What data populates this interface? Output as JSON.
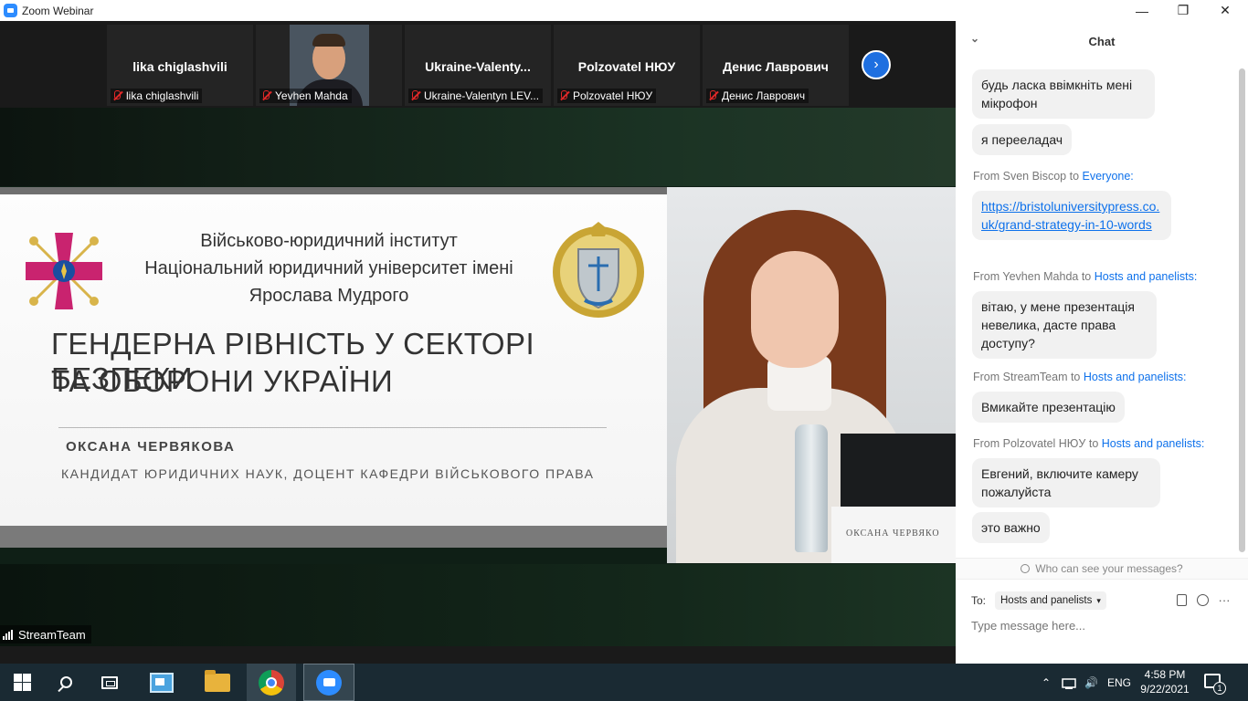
{
  "window": {
    "title": "Zoom Webinar",
    "minimize": "—",
    "restore": "❐",
    "close": "✕"
  },
  "participants": [
    {
      "name": "lika chiglashvili",
      "label": "lika chiglashvili"
    },
    {
      "name": "",
      "label": "Yevhen Mahda"
    },
    {
      "name": "Ukraine-Valenty...",
      "label": "Ukraine-Valentyn LEV..."
    },
    {
      "name": "Polzovatel НЮУ",
      "label": "Polzovatel НЮУ"
    },
    {
      "name": "Денис Лаврович",
      "label": "Денис Лаврович"
    }
  ],
  "next_arrow": "›",
  "slide": {
    "institute_line1": "Військово-юридичний інститут",
    "institute_line2": "Національний юридичний університет імені",
    "institute_line3": "Ярослава Мудрого",
    "title_line1": "ГЕНДЕРНА РІВНІСТЬ У СЕКТОРІ БЕЗПЕКИ",
    "title_line2": "ТА ОБОРОНИ УКРАЇНИ",
    "author": "ОКСАНА ЧЕРВЯКОВА",
    "degree": "КАНДИДАТ ЮРИДИЧНИХ НАУК, ДОЦЕНТ КАФЕДРИ ВІЙСЬКОВОГО ПРАВА"
  },
  "speaker_nameplate": "ОКСАНА ЧЕРВЯКО",
  "active_speaker": "StreamTeam",
  "chat": {
    "title": "Chat",
    "collapse_icon": "⌄",
    "messages": [
      {
        "text": "будь ласка ввімкніть мені мікрофон"
      },
      {
        "text": "я переeладач"
      },
      {
        "from": "From Sven Biscop to ",
        "to": "Everyone:",
        "text": "https://bristoluniversitypress.co.uk/grand-strategy-in-10-words"
      },
      {
        "from": "From Yevhen Mahda to ",
        "to": "Hosts and panelists:",
        "text": "вітаю, у мене презентація невелика, дасте права доступу?"
      },
      {
        "from": "From StreamTeam to ",
        "to": "Hosts and panelists:",
        "text": "Вмикайте презентацію"
      },
      {
        "from": "From Polzovatel НЮУ to ",
        "to": "Hosts and panelists:",
        "text": "Евгений, включите камеру пожалуйста"
      },
      {
        "text": "это важно"
      }
    ],
    "privacy": "Who can see your messages?",
    "to_label": "To:",
    "recipient": "Hosts and panelists",
    "more": "···",
    "placeholder": "Type message here..."
  },
  "taskbar": {
    "lang": "ENG",
    "time": "4:58 PM",
    "date": "9/22/2021",
    "notif_count": "1",
    "tray_up": "⌃",
    "volume": "🔊"
  },
  "colors": {
    "accent": "#0e71eb",
    "muted_red": "#e02828",
    "zoom_blue": "#2d8cff"
  }
}
